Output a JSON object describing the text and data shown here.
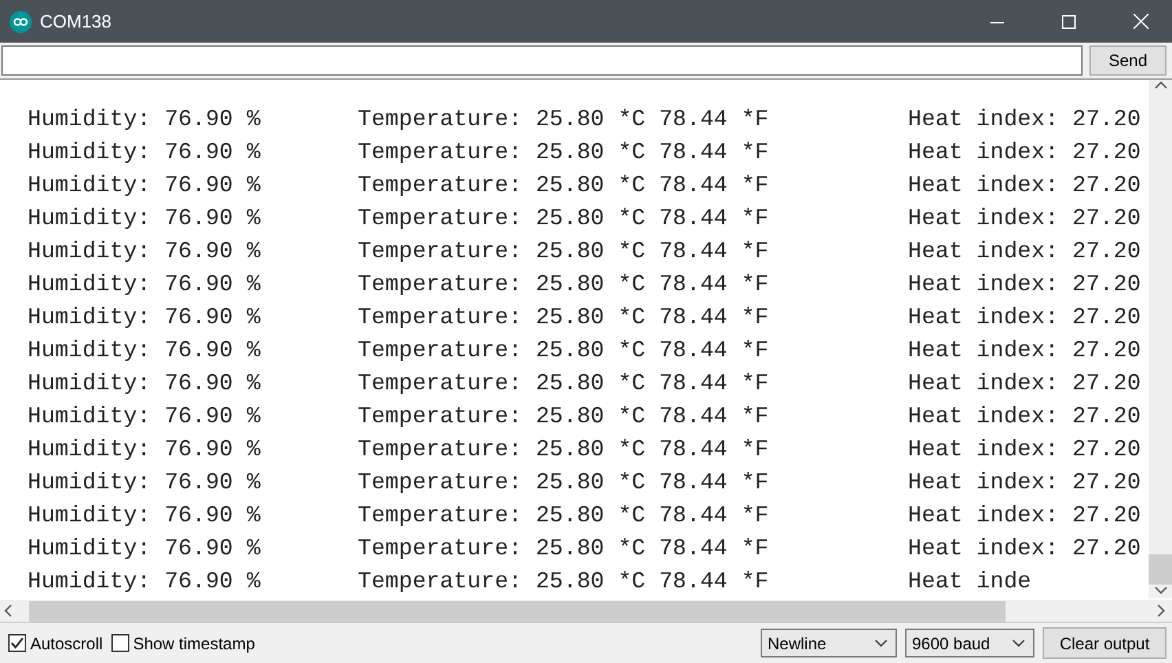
{
  "window": {
    "title": "COM138"
  },
  "input": {
    "button": "Send"
  },
  "output": {
    "rows": [
      {
        "humidity": "Humidity: 76.90 %",
        "temperature": "Temperature: 25.80 *C 78.44 *F",
        "heat": "Heat index: 27.20"
      },
      {
        "humidity": "Humidity: 76.90 %",
        "temperature": "Temperature: 25.80 *C 78.44 *F",
        "heat": "Heat index: 27.20"
      },
      {
        "humidity": "Humidity: 76.90 %",
        "temperature": "Temperature: 25.80 *C 78.44 *F",
        "heat": "Heat index: 27.20"
      },
      {
        "humidity": "Humidity: 76.90 %",
        "temperature": "Temperature: 25.80 *C 78.44 *F",
        "heat": "Heat index: 27.20"
      },
      {
        "humidity": "Humidity: 76.90 %",
        "temperature": "Temperature: 25.80 *C 78.44 *F",
        "heat": "Heat index: 27.20"
      },
      {
        "humidity": "Humidity: 76.90 %",
        "temperature": "Temperature: 25.80 *C 78.44 *F",
        "heat": "Heat index: 27.20"
      },
      {
        "humidity": "Humidity: 76.90 %",
        "temperature": "Temperature: 25.80 *C 78.44 *F",
        "heat": "Heat index: 27.20"
      },
      {
        "humidity": "Humidity: 76.90 %",
        "temperature": "Temperature: 25.80 *C 78.44 *F",
        "heat": "Heat index: 27.20"
      },
      {
        "humidity": "Humidity: 76.90 %",
        "temperature": "Temperature: 25.80 *C 78.44 *F",
        "heat": "Heat index: 27.20"
      },
      {
        "humidity": "Humidity: 76.90 %",
        "temperature": "Temperature: 25.80 *C 78.44 *F",
        "heat": "Heat index: 27.20"
      },
      {
        "humidity": "Humidity: 76.90 %",
        "temperature": "Temperature: 25.80 *C 78.44 *F",
        "heat": "Heat index: 27.20"
      },
      {
        "humidity": "Humidity: 76.90 %",
        "temperature": "Temperature: 25.80 *C 78.44 *F",
        "heat": "Heat index: 27.20"
      },
      {
        "humidity": "Humidity: 76.90 %",
        "temperature": "Temperature: 25.80 *C 78.44 *F",
        "heat": "Heat index: 27.20"
      },
      {
        "humidity": "Humidity: 76.90 %",
        "temperature": "Temperature: 25.80 *C 78.44 *F",
        "heat": "Heat index: 27.20"
      },
      {
        "humidity": "Humidity: 76.90 %",
        "temperature": "Temperature: 25.80 *C 78.44 *F",
        "heat": "Heat inde"
      }
    ]
  },
  "footer": {
    "autoscroll": {
      "label": "Autoscroll",
      "checked": true
    },
    "timestamp": {
      "label": "Show timestamp",
      "checked": false
    },
    "line_ending": "Newline",
    "baud": "9600 baud",
    "clear": "Clear output"
  }
}
